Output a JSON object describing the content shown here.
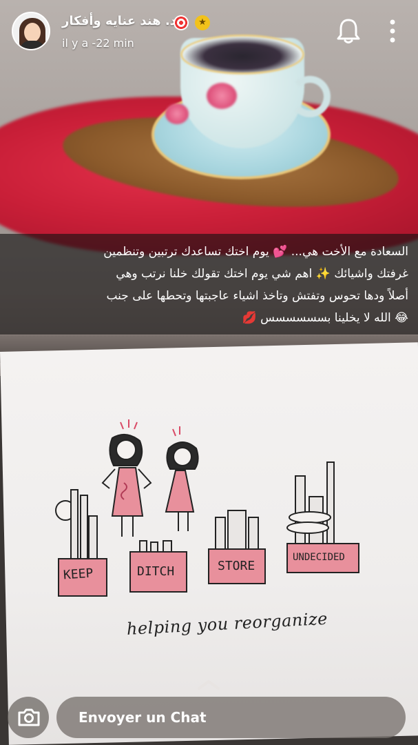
{
  "header": {
    "display_name": "د. هند عنايه وأفكار",
    "timestamp": "il y a -22 min",
    "badges": [
      "target-emoji",
      "star-badge"
    ],
    "star_glyph": "★",
    "icons": {
      "notification": "bell-icon",
      "more": "more-vertical-icon"
    }
  },
  "caption": {
    "lines": [
      "السعادة مع الأخت هي... 💕 يوم اختك تساعدك ترتبين وتنظمين",
      "غرفتك واشيائك ✨ اهم شي يوم اختك تقولك خلنا نرتب وهي",
      "أصلاً ودها تحوس وتفتش وتاخذ اشياء عاجبتها وتحطها على جنب",
      "😂 الله لا يخلينا بسسسسسس 💋"
    ]
  },
  "illustration": {
    "box_labels": [
      "KEEP",
      "DITCH",
      "STORE",
      "UNDECIDED"
    ],
    "tagline": "helping you reorganize"
  },
  "footer": {
    "chat_placeholder": "Envoyer un Chat",
    "icons": {
      "camera": "camera-icon",
      "swipe_up": "chevron-up-icon"
    }
  },
  "colors": {
    "box_pink": "#e8909c",
    "star_yellow": "#f2c21a"
  }
}
